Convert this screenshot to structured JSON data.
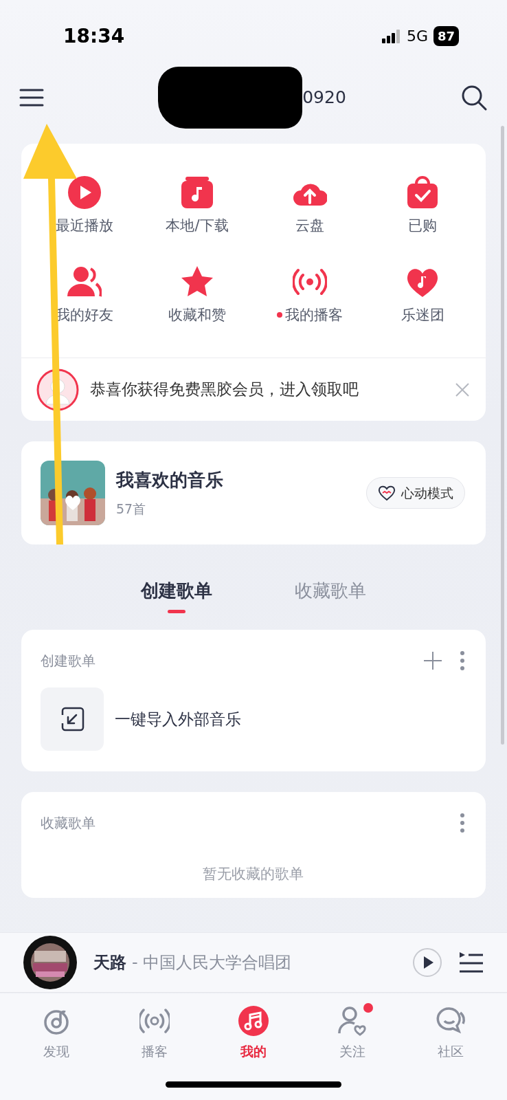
{
  "status_bar": {
    "time": "18:34",
    "network": "5G",
    "battery": "87"
  },
  "header": {
    "username": "0920"
  },
  "shortcuts": [
    {
      "label": "最近播放",
      "kind": "play",
      "dot": false
    },
    {
      "label": "本地/下载",
      "kind": "local",
      "dot": false
    },
    {
      "label": "云盘",
      "kind": "cloud",
      "dot": false
    },
    {
      "label": "已购",
      "kind": "bag",
      "dot": false
    },
    {
      "label": "我的好友",
      "kind": "friends",
      "dot": false
    },
    {
      "label": "收藏和赞",
      "kind": "star",
      "dot": false
    },
    {
      "label": "我的播客",
      "kind": "podcast",
      "dot": true
    },
    {
      "label": "乐迷团",
      "kind": "heart",
      "dot": false
    }
  ],
  "promo": {
    "text": "恭喜你获得免费黑胶会员，进入领取吧"
  },
  "liked": {
    "title": "我喜欢的音乐",
    "count": "57首",
    "mode_button": "心动模式"
  },
  "playlist_tabs": [
    {
      "label": "创建歌单",
      "selected": true
    },
    {
      "label": "收藏歌单",
      "selected": false
    }
  ],
  "created_section": {
    "title": "创建歌单",
    "items": [
      {
        "label": "一键导入外部音乐"
      }
    ]
  },
  "collected_section": {
    "title": "收藏歌单",
    "empty_text": "暂无收藏的歌单"
  },
  "now_playing": {
    "title": "天路",
    "artist": "- 中国人民大学合唱团"
  },
  "tab_bar": [
    {
      "label": "发现",
      "kind": "discover",
      "selected": false,
      "dot": false
    },
    {
      "label": "播客",
      "kind": "podcast",
      "selected": false,
      "dot": false
    },
    {
      "label": "我的",
      "kind": "music",
      "selected": true,
      "dot": false
    },
    {
      "label": "关注",
      "kind": "follow",
      "selected": false,
      "dot": true
    },
    {
      "label": "社区",
      "kind": "community",
      "selected": false,
      "dot": false
    }
  ]
}
